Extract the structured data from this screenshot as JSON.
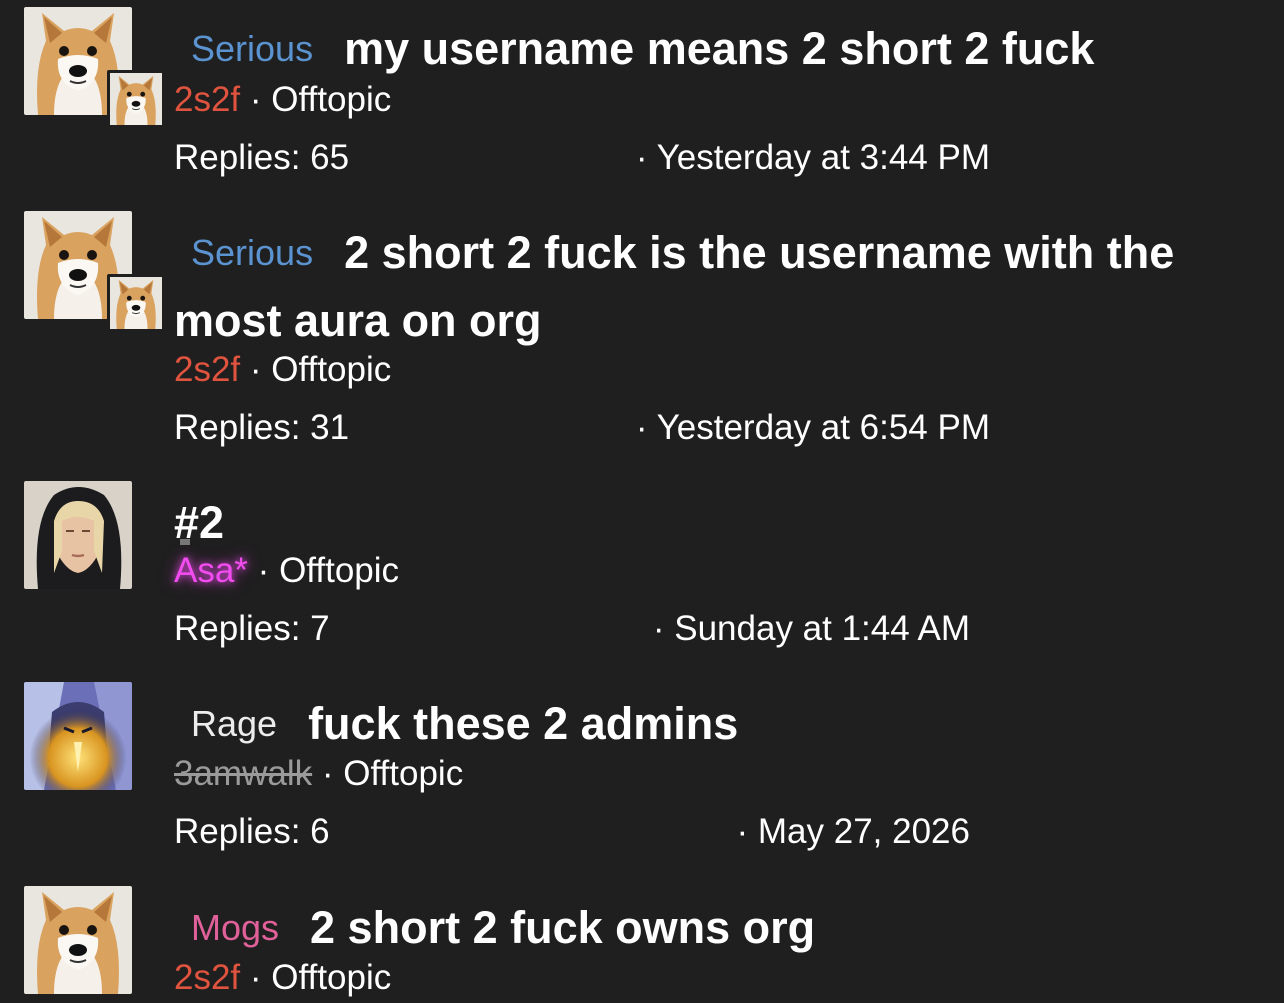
{
  "threads": [
    {
      "prefix": "Serious",
      "title": "my username means 2 short 2 fuck",
      "author": "2s2f",
      "forum": "Offtopic",
      "replies": "Replies: 65",
      "date": "Yesterday at 3:44 PM",
      "separator": "·"
    },
    {
      "prefix": "Serious",
      "title": "2 short 2 fuck is the username with the most aura on org",
      "author": "2s2f",
      "forum": "Offtopic",
      "replies": "Replies: 31",
      "date": "Yesterday at 6:54 PM",
      "separator": "·"
    },
    {
      "prefix": "",
      "title": "#2",
      "author": "Asa*",
      "forum": "Offtopic",
      "replies": "Replies: 7",
      "date": "Sunday at 1:44 AM",
      "separator": "·"
    },
    {
      "prefix": "Rage",
      "title": "fuck these 2 admins",
      "author": "3amwalk",
      "forum": "Offtopic",
      "replies": "Replies: 6",
      "date": "May 27, 2026",
      "separator": "·"
    },
    {
      "prefix": "Mogs",
      "title": "2 short 2 fuck owns org",
      "author": "2s2f",
      "forum": "Offtopic",
      "separator": "·"
    }
  ],
  "colors": {
    "background": "#1f1f1f",
    "prefix_serious": "#5a93cf",
    "prefix_mogs": "#e0609a",
    "user_2s2f": "#e0533e",
    "user_asa": "#f24cf0",
    "user_3amwalk": "#9a9a9a"
  },
  "icons": {
    "avatar_dog": "dog-avatar-icon",
    "avatar_girl": "hooded-person-avatar-icon",
    "avatar_anime": "anime-character-avatar-icon"
  }
}
